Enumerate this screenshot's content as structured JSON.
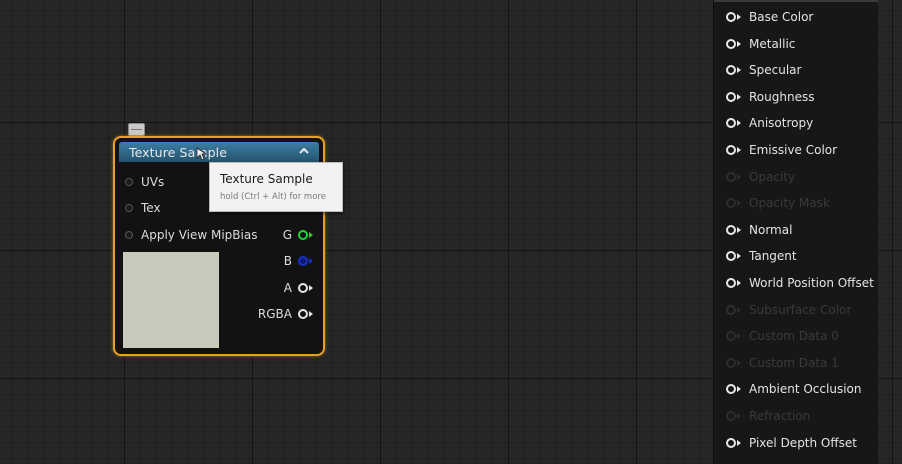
{
  "node": {
    "title": "Texture Sample",
    "inputs": [
      {
        "label": "UVs"
      },
      {
        "label": "Tex"
      },
      {
        "label": "Apply View MipBias"
      }
    ],
    "outputs": [
      {
        "label": "G",
        "color": "#25d234"
      },
      {
        "label": "B",
        "color": "#1830c8"
      },
      {
        "label": "A",
        "color": "#e6e6e6"
      },
      {
        "label": "RGBA",
        "color": "#e6e6e6"
      }
    ],
    "accent_color": "#e8a020",
    "header_color": "#3c7ea3",
    "thumbnail_color": "#cacabc",
    "collapse_icon": "chevron-up-icon"
  },
  "tooltip": {
    "title": "Texture Sample",
    "hint": "hold (Ctrl + Alt) for more"
  },
  "material_inputs": [
    {
      "label": "Base Color",
      "enabled": true
    },
    {
      "label": "Metallic",
      "enabled": true
    },
    {
      "label": "Specular",
      "enabled": true
    },
    {
      "label": "Roughness",
      "enabled": true
    },
    {
      "label": "Anisotropy",
      "enabled": true
    },
    {
      "label": "Emissive Color",
      "enabled": true
    },
    {
      "label": "Opacity",
      "enabled": false
    },
    {
      "label": "Opacity Mask",
      "enabled": false
    },
    {
      "label": "Normal",
      "enabled": true
    },
    {
      "label": "Tangent",
      "enabled": true
    },
    {
      "label": "World Position Offset",
      "enabled": true
    },
    {
      "label": "Subsurface Color",
      "enabled": false
    },
    {
      "label": "Custom Data 0",
      "enabled": false
    },
    {
      "label": "Custom Data 1",
      "enabled": false
    },
    {
      "label": "Ambient Occlusion",
      "enabled": true
    },
    {
      "label": "Refraction",
      "enabled": false
    },
    {
      "label": "Pixel Depth Offset",
      "enabled": true
    }
  ]
}
